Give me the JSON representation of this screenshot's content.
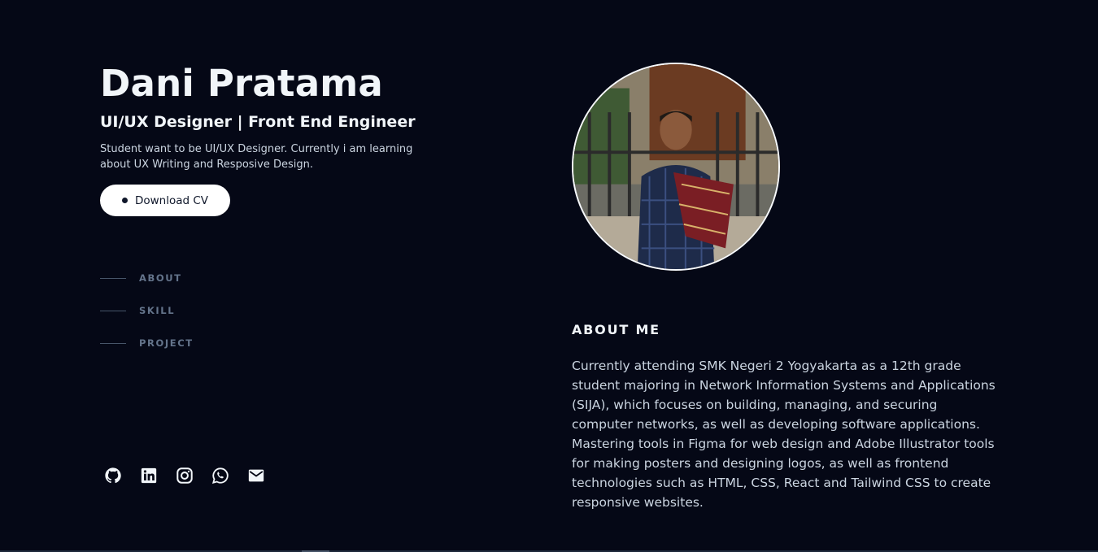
{
  "profile": {
    "name": "Dani Pratama",
    "role": "UI/UX Designer | Front End Engineer",
    "tagline": "Student want to be UI/UX Designer. Currently i am learning about UX Writing and Resposive Design.",
    "download_label": "Download CV"
  },
  "nav": {
    "items": [
      {
        "label": "ABOUT"
      },
      {
        "label": "SKILL"
      },
      {
        "label": "PROJECT"
      }
    ]
  },
  "socials": [
    "github-icon",
    "linkedin-icon",
    "instagram-icon",
    "whatsapp-icon",
    "mail-icon"
  ],
  "about": {
    "heading": "ABOUT ME",
    "text": "Currently attending SMK Negeri 2 Yogyakarta as a 12th grade student majoring in Network Information Systems and Applications (SIJA), which focuses on building, managing, and securing computer networks, as well as developing software applications. Mastering tools in Figma for web design and Adobe Illustrator tools for making posters and designing logos, as well as frontend technologies such as HTML, CSS, React and Tailwind CSS to create responsive websites."
  },
  "colors": {
    "background": "#050816",
    "text_primary": "#f1f5f9",
    "text_muted": "#64748b",
    "button_bg": "#ffffff"
  }
}
